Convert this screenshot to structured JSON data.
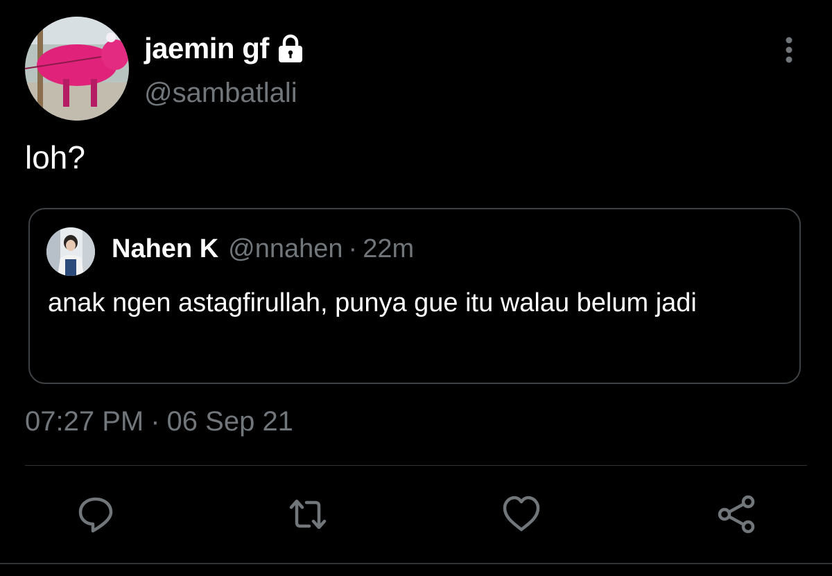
{
  "author": {
    "display_name": "jaemin gf",
    "handle": "@sambatlali",
    "locked": true,
    "avatar": "pink-sheep-photo"
  },
  "tweet": {
    "text": "loh?",
    "time": "07:27 PM",
    "separator": "·",
    "date": "06 Sep 21"
  },
  "quoted_tweet": {
    "display_name": "Nahen K",
    "handle": "@nnahen",
    "separator": "·",
    "time_ago": "22m",
    "text": "anak ngen astagfirullah, punya gue itu walau belum jadi",
    "avatar": "person-photo"
  },
  "actions": {
    "reply_icon": "reply-icon",
    "retweet_icon": "retweet-icon",
    "like_icon": "heart-icon",
    "share_icon": "share-icon"
  },
  "colors": {
    "background": "#000000",
    "primary_text": "#ffffff",
    "secondary_text": "#71767b",
    "border": "#3e4144",
    "icon": "#71767b"
  }
}
